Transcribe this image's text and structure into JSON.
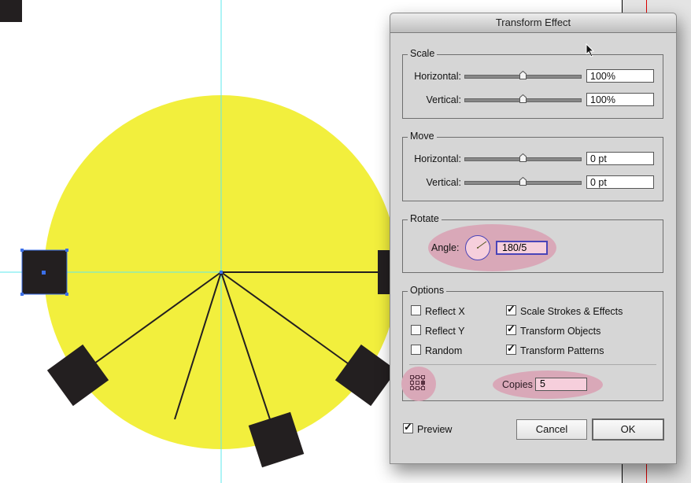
{
  "dialog": {
    "title": "Transform Effect",
    "scale": {
      "legend": "Scale",
      "horizontal_label": "Horizontal:",
      "horizontal_value": "100%",
      "horizontal_slider": 0.5,
      "vertical_label": "Vertical:",
      "vertical_value": "100%",
      "vertical_slider": 0.5
    },
    "move": {
      "legend": "Move",
      "horizontal_label": "Horizontal:",
      "horizontal_value": "0 pt",
      "horizontal_slider": 0.5,
      "vertical_label": "Vertical:",
      "vertical_value": "0 pt",
      "vertical_slider": 0.5
    },
    "rotate": {
      "legend": "Rotate",
      "angle_label": "Angle:",
      "angle_value": "180/5",
      "dial_icon": "angle-dial-icon"
    },
    "options": {
      "legend": "Options",
      "checkboxes": [
        {
          "label": "Reflect X",
          "checked": false
        },
        {
          "label": "Reflect Y",
          "checked": false
        },
        {
          "label": "Random",
          "checked": false
        },
        {
          "label": "Scale Strokes & Effects",
          "checked": true
        },
        {
          "label": "Transform Objects",
          "checked": true
        },
        {
          "label": "Transform Patterns",
          "checked": true
        }
      ],
      "reference_point_icon": "reference-point-locator-icon",
      "copies_label": "Copies",
      "copies_value": "5"
    },
    "preview_label": "Preview",
    "preview_checked": true,
    "cancel_label": "Cancel",
    "ok_label": "OK"
  },
  "colors": {
    "circle": "#f2ef3d",
    "squares": "#231f20",
    "guides": "#5ee8ee",
    "highlight": "#d9a8b8",
    "selection": "#3b6fe8"
  }
}
